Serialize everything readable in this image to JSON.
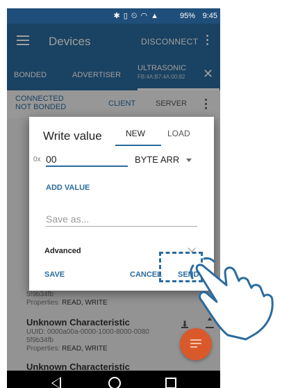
{
  "status_bar": {
    "icons": "✱ ▯ ⏲ ◠ ▲",
    "battery": "95%",
    "time": "9:45"
  },
  "app_bar": {
    "title": "Devices",
    "disconnect_label": "DISCONNECT"
  },
  "tabs": {
    "bonded": "BONDED",
    "advertiser": "ADVERTISER",
    "active_name": "ULTRASONIC",
    "active_mac": "FB:4A:B7:4A:00:82"
  },
  "connection": {
    "status": "CONNECTED",
    "bond": "NOT BONDED",
    "client": "CLIENT",
    "server": "SERVER"
  },
  "characteristics": [
    {
      "uuid": "5f9b34fb",
      "props_label": "Properties:",
      "props": "READ, WRITE"
    },
    {
      "name": "Unknown Characteristic",
      "uuid_label": "UUID:",
      "uuid": "0000a00a-0000-1000-8000-0080",
      "uuid_cont": "5f9b34fb",
      "props_label": "Properties:",
      "props": "READ, WRITE"
    },
    {
      "name": "Unknown Characteristic"
    }
  ],
  "dialog": {
    "title": "Write value",
    "tab_new": "NEW",
    "tab_load": "LOAD",
    "prefix": "0x",
    "value": "00",
    "type": "BYTE ARR",
    "add_value": "ADD VALUE",
    "save_as_placeholder": "Save as...",
    "advanced": "Advanced",
    "save": "SAVE",
    "cancel": "CANCEL",
    "send": "SEND"
  },
  "colors": {
    "primary": "#2a6b9e",
    "status_bar": "#1f4e7a",
    "fab": "#d9592b",
    "highlight": "#2a6b9e"
  }
}
